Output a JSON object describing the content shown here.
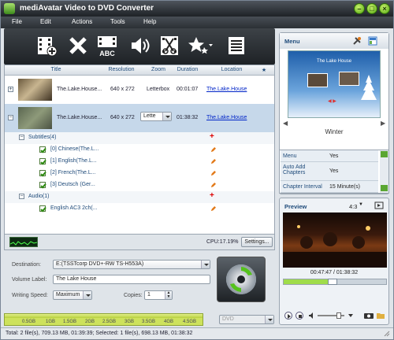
{
  "app": {
    "title": "mediAvatar Video to DVD Converter"
  },
  "menu": [
    "File",
    "Edit",
    "Actions",
    "Tools",
    "Help"
  ],
  "columns": {
    "title": "Title",
    "resolution": "Resolution",
    "zoom": "Zoom",
    "duration": "Duration",
    "location": "Location",
    "star": "★"
  },
  "rows": [
    {
      "title": "The.Lake.House...",
      "resolution": "640 x 272",
      "zoom": "Letterbox",
      "duration": "00:01:07",
      "location": "The.Lake.House"
    },
    {
      "title": "The.Lake.House...",
      "resolution": "640 x 272",
      "zoom": "Lette",
      "duration": "01:38:32",
      "location": "The.Lake.House"
    }
  ],
  "subtitles": {
    "label": "Subtitles(4)",
    "items": [
      "[0] Chinese(The.L...",
      "[1] English(The.L...",
      "[2] French(The.L...",
      "[3] Deutsch (Ger..."
    ]
  },
  "audio": {
    "label": "Audio(1)",
    "items": [
      "English AC3 2ch(..."
    ]
  },
  "cpu": "CPU:17.19%",
  "settings_button": "Settings...",
  "destination": {
    "label": "Destination:",
    "value": "E:(TSSTcorp DVD+-RW TS-H553A)"
  },
  "volume": {
    "label": "Volume Label:",
    "value": "The Lake House"
  },
  "writing_speed": {
    "label": "Writing Speed:",
    "value": "Maximum"
  },
  "copies": {
    "label": "Copies:",
    "value": "1"
  },
  "capacity": {
    "ticks": [
      "0.5GB",
      "1GB",
      "1.5GB",
      "2GB",
      "2.5GB",
      "3GB",
      "3.5GB",
      "4GB",
      "4.5GB"
    ],
    "disc_type": "DVD"
  },
  "menu_panel": {
    "title": "Menu",
    "menu_title": "The Lake House",
    "theme": "Winter"
  },
  "settings": [
    {
      "key": "Menu",
      "value": "Yes"
    },
    {
      "key": "Auto Add Chapters",
      "value": "Yes"
    },
    {
      "key": "Chapter Interval",
      "value": "15 Minute(s)"
    }
  ],
  "preview": {
    "title": "Preview",
    "aspect": "4:3",
    "time": "00:47:47 / 01:38:32"
  },
  "status": "Total: 2 file(s), 709.13 MB,  01:39:39; Selected: 1 file(s), 698.13 MB,  01:38:32",
  "colors": {
    "accent": "#cde25c",
    "titlebar": "#2b3035",
    "link": "#0024c8"
  }
}
